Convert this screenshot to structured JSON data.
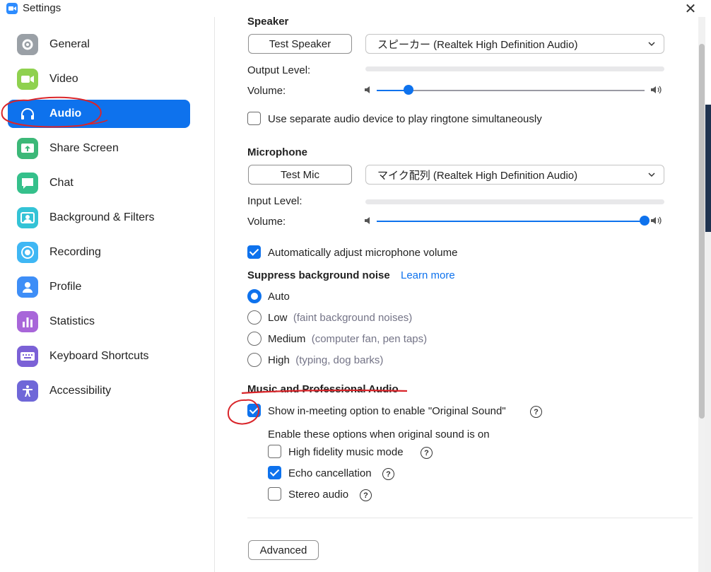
{
  "window": {
    "title": "Settings",
    "close_glyph": "✕"
  },
  "sidebar": {
    "items": [
      {
        "label": "General",
        "icon": "gear-icon",
        "color": "#9AA0A6"
      },
      {
        "label": "Video",
        "icon": "video-icon",
        "color": "#8FD14F"
      },
      {
        "label": "Audio",
        "icon": "headphones-icon",
        "color": "#0E72ED",
        "active": true
      },
      {
        "label": "Share Screen",
        "icon": "share-screen-icon",
        "color": "#3CB878"
      },
      {
        "label": "Chat",
        "icon": "chat-icon",
        "color": "#35C08B"
      },
      {
        "label": "Background & Filters",
        "icon": "background-icon",
        "color": "#34C3D6"
      },
      {
        "label": "Recording",
        "icon": "recording-icon",
        "color": "#3FB7F4"
      },
      {
        "label": "Profile",
        "icon": "profile-icon",
        "color": "#3E8EF7"
      },
      {
        "label": "Statistics",
        "icon": "statistics-icon",
        "color": "#A866D9"
      },
      {
        "label": "Keyboard Shortcuts",
        "icon": "keyboard-icon",
        "color": "#7B61D6"
      },
      {
        "label": "Accessibility",
        "icon": "accessibility-icon",
        "color": "#6F67D8"
      }
    ]
  },
  "speaker": {
    "section_title": "Speaker",
    "test_button": "Test Speaker",
    "device": "スピーカー (Realtek High Definition Audio)",
    "output_level_label": "Output Level:",
    "volume_label": "Volume:",
    "volume_fraction": 0.12
  },
  "ringtone_option": {
    "label": "Use separate audio device to play ringtone simultaneously",
    "checked": false
  },
  "microphone": {
    "section_title": "Microphone",
    "test_button": "Test Mic",
    "device": "マイク配列 (Realtek High Definition Audio)",
    "input_level_label": "Input Level:",
    "volume_label": "Volume:",
    "volume_fraction": 1.0
  },
  "auto_adjust": {
    "label": "Automatically adjust microphone volume",
    "checked": true
  },
  "suppress": {
    "title": "Suppress background noise",
    "learn_more": "Learn more",
    "options": [
      {
        "label": "Auto",
        "hint": "",
        "selected": true
      },
      {
        "label": "Low",
        "hint": "(faint background noises)",
        "selected": false
      },
      {
        "label": "Medium",
        "hint": "(computer fan, pen taps)",
        "selected": false
      },
      {
        "label": "High",
        "hint": "(typing, dog barks)",
        "selected": false
      }
    ]
  },
  "music": {
    "title": "Music and Professional Audio",
    "original_sound": {
      "label": "Show in-meeting option to enable \"Original Sound\"",
      "checked": true
    },
    "sub_caption": "Enable these options when original sound is on",
    "sub_options": [
      {
        "label": "High fidelity music mode",
        "checked": false
      },
      {
        "label": "Echo cancellation",
        "checked": true
      },
      {
        "label": "Stereo audio",
        "checked": false
      }
    ],
    "help_glyph": "?"
  },
  "advanced_button": "Advanced",
  "colors": {
    "accent": "#0E72ED",
    "annotation": "#D9252A"
  }
}
